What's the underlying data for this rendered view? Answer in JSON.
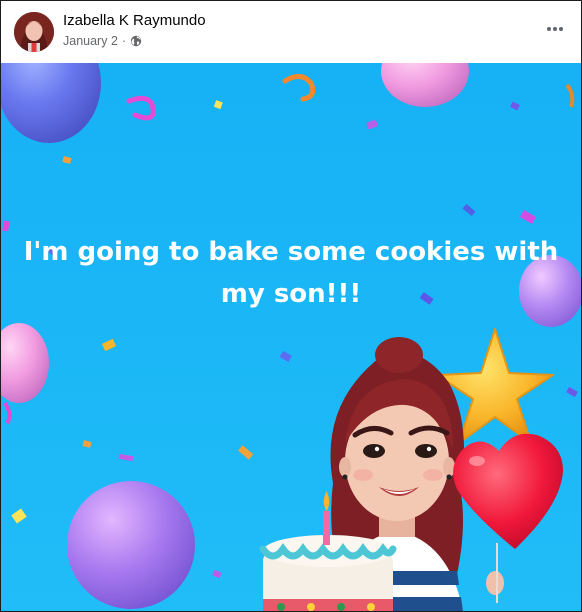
{
  "post": {
    "author": "Izabella K Raymundo",
    "date": "January 2",
    "separator": "·",
    "privacy_icon": "globe-icon",
    "more_icon": "more-options-icon",
    "text": "I'm going to bake some cookies with my son!!!"
  },
  "background": {
    "color": "#1ab6f6",
    "theme": "celebration",
    "decorations": [
      "balloon-icon",
      "confetti-icon",
      "star-balloon-icon",
      "heart-balloon-icon",
      "birthday-cake-icon",
      "avatar-illustration"
    ]
  }
}
